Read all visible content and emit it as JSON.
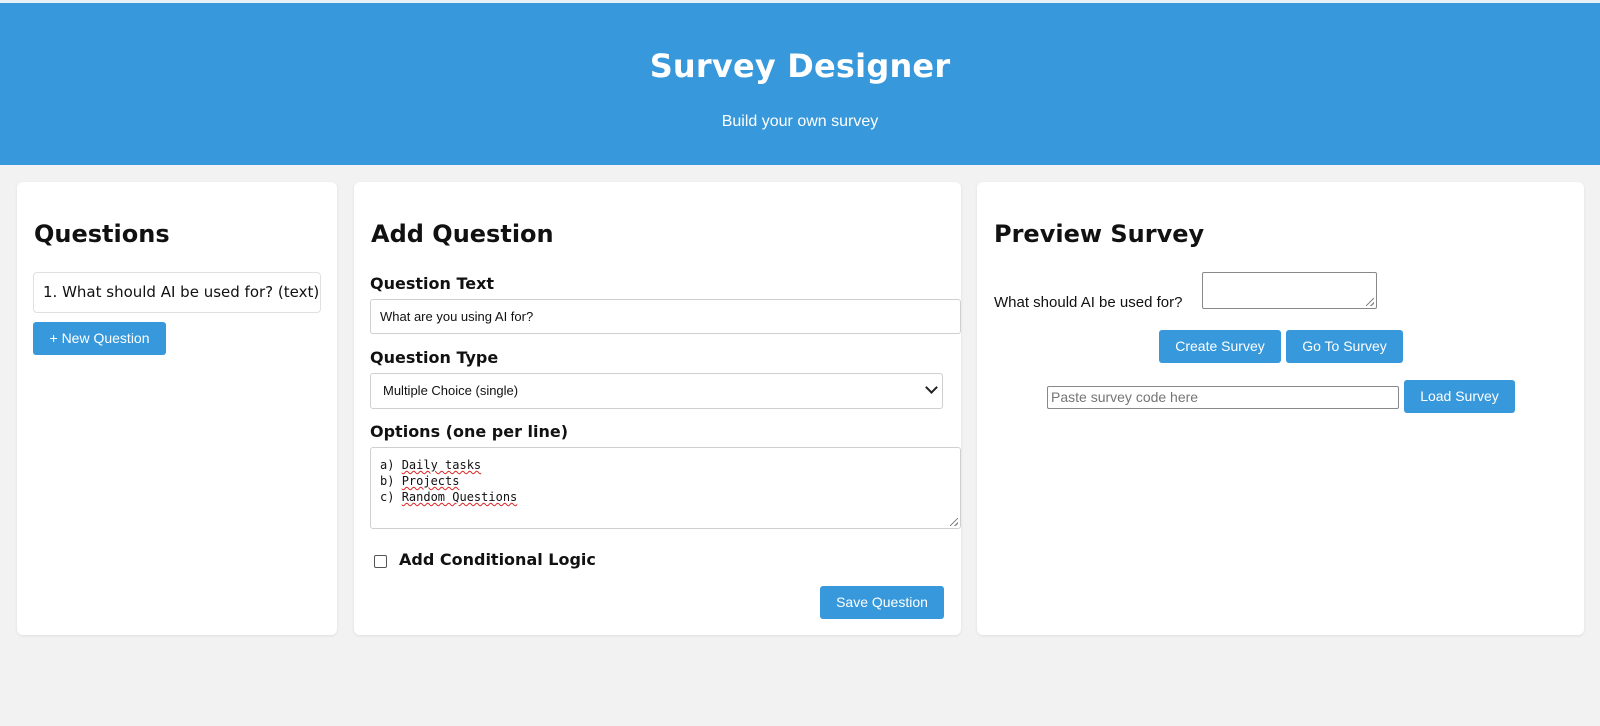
{
  "header": {
    "title": "Survey Designer",
    "subtitle": "Build your own survey",
    "color": "#3798db"
  },
  "questions_panel": {
    "heading": "Questions",
    "items": [
      {
        "label": "1. What should AI be used for? (text)"
      }
    ],
    "new_question_label": "+ New Question"
  },
  "add_question_panel": {
    "heading": "Add Question",
    "question_text_label": "Question Text",
    "question_text_value": "What are you using AI for?",
    "question_type_label": "Question Type",
    "question_type_value": "Multiple Choice (single)",
    "options_label": "Options (one per line)",
    "options_lines": [
      {
        "prefix": "a) ",
        "text": "Daily tasks"
      },
      {
        "prefix": "b) ",
        "text": "Projects"
      },
      {
        "prefix": "c) ",
        "text": "Random Questions"
      }
    ],
    "conditional_label": "Add Conditional Logic",
    "conditional_checked": false,
    "save_label": "Save Question"
  },
  "preview_panel": {
    "heading": "Preview Survey",
    "question_label": "What should AI be used for?",
    "create_label": "Create Survey",
    "go_to_label": "Go To Survey",
    "code_placeholder": "Paste survey code here",
    "load_label": "Load Survey"
  }
}
